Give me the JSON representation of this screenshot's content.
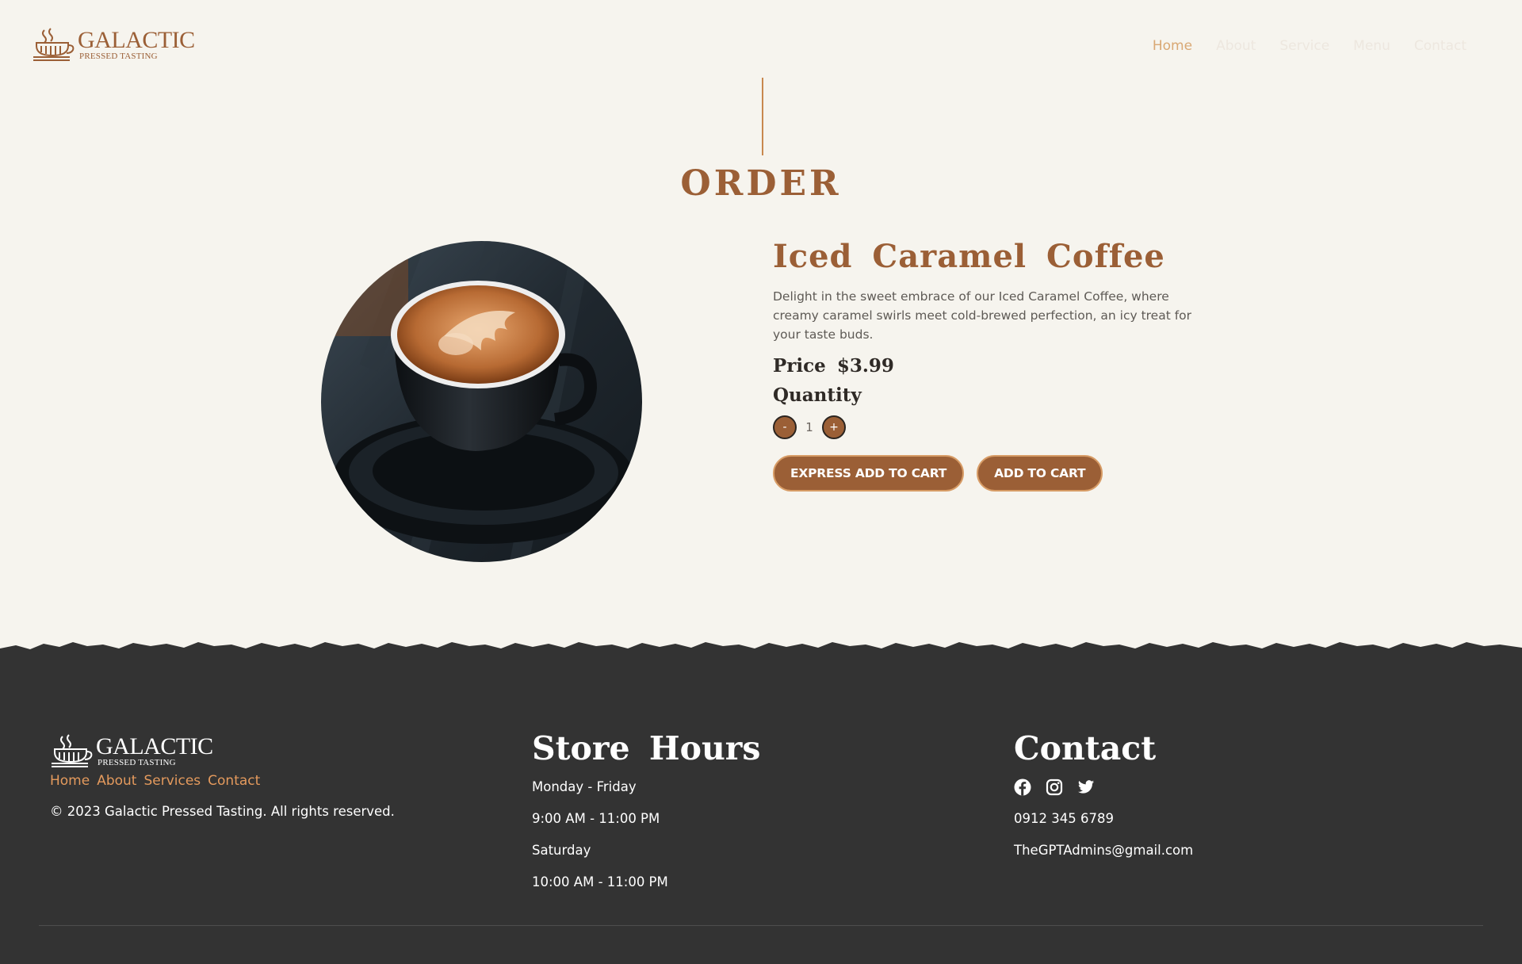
{
  "brand": {
    "name": "GALACTIC",
    "tagline": "PRESSED TASTING"
  },
  "nav": {
    "items": [
      "Home",
      "About",
      "Service",
      "Menu",
      "Contact"
    ],
    "active": "Home"
  },
  "order": {
    "title": "ORDER",
    "product_name": "Iced Caramel Coffee",
    "description": "Delight in the sweet embrace of our Iced Caramel Coffee, where creamy caramel swirls meet cold-brewed perfection, an icy treat for your taste buds.",
    "price_label": "Price",
    "price": "$3.99",
    "quantity_label": "Quantity",
    "quantity": "1",
    "decrement": "-",
    "increment": "+",
    "express_button": "EXPRESS ADD TO CART",
    "cart_button": "ADD TO CART"
  },
  "footer": {
    "links": [
      "Home",
      "About",
      "Services",
      "Contact"
    ],
    "copyright": "© 2023 Galactic Pressed Tasting. All rights reserved.",
    "hours_title": "Store Hours",
    "hours": [
      "Monday - Friday",
      "9:00 AM - 11:00 PM",
      "Saturday",
      "10:00 AM - 11:00 PM"
    ],
    "contact_title": "Contact",
    "social_icons": [
      "facebook-icon",
      "instagram-icon",
      "twitter-icon"
    ],
    "phone": "0912 345 6789",
    "email": "TheGPTAdmins@gmail.com"
  },
  "colors": {
    "background": "#f6f4ee",
    "brand_brown": "#9b5f36",
    "nav_active": "#d9a874",
    "footer_bg": "#333333",
    "footer_link": "#e49a5d"
  }
}
